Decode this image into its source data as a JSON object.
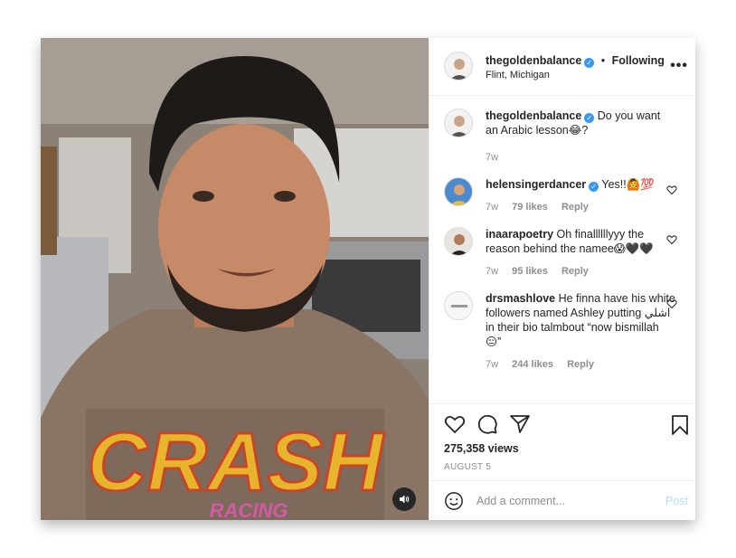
{
  "post": {
    "username": "thegoldenbalance",
    "separator": "•",
    "following": "Following",
    "location": "Flint, Michigan",
    "more": "•••"
  },
  "caption": {
    "username": "thegoldenbalance",
    "text": "Do you want an Arabic lesson😂?",
    "age": "7w"
  },
  "comments": [
    {
      "username": "helensingerdancer",
      "verified": true,
      "text": "Yes!!🙆💯",
      "age": "7w",
      "likes": "79 likes",
      "reply": "Reply"
    },
    {
      "username": "inaarapoetry",
      "verified": false,
      "text": "Oh finallllllyyy the reason behind the namee😱🖤🖤",
      "age": "7w",
      "likes": "95 likes",
      "reply": "Reply"
    },
    {
      "username": "drsmashlove",
      "verified": false,
      "text": "He finna have his white followers named Ashley putting اشلي in their bio talmbout “now bismillah 😑”",
      "age": "7w",
      "likes": "244 likes",
      "reply": "Reply"
    }
  ],
  "stats": {
    "views": "275,358 views",
    "date": "AUGUST 5"
  },
  "composer": {
    "placeholder": "Add a comment...",
    "post_label": "Post"
  },
  "video": {
    "shirt_text": "CRASH",
    "shirt_subtext": "RACING"
  },
  "colors": {
    "verified": "#3897f0",
    "post_button": "#b2dffc",
    "muted": "#8e8e8e"
  }
}
